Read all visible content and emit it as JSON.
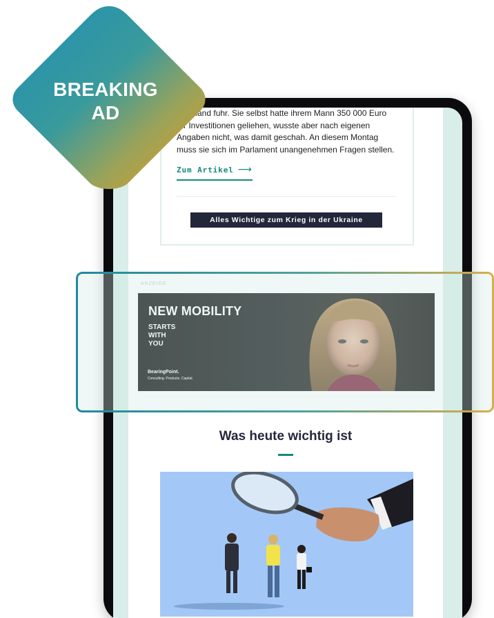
{
  "article": {
    "text": "Russland fuhr. Sie selbst hatte ihrem Mann 350 000 Euro für Investitionen geliehen, wusste aber nach eigenen Angaben nicht, was damit geschah. An diesem Montag muss sie sich im Parlament unangenehmen Fragen stellen.",
    "link_label": "Zum Artikel",
    "link_icon": "arrow-right-icon"
  },
  "ukraine_button": {
    "label": "Alles Wichtige zum Krieg in der Ukraine"
  },
  "ad": {
    "label": "ANZEIGE",
    "headline": "NEW MOBILITY",
    "subline": "STARTS WITH YOU",
    "brand": "BearingPoint.",
    "tagline": "Consulting. Products. Capital."
  },
  "section": {
    "title": "Was heute wichtig ist"
  },
  "badge": {
    "line1": "BREAKING",
    "line2": "AD"
  },
  "colors": {
    "accent": "#17887a",
    "button_bg": "#22273a",
    "badge_start": "#1f8fb0",
    "badge_end": "#e0a020",
    "background_tint": "#d9ede9"
  }
}
